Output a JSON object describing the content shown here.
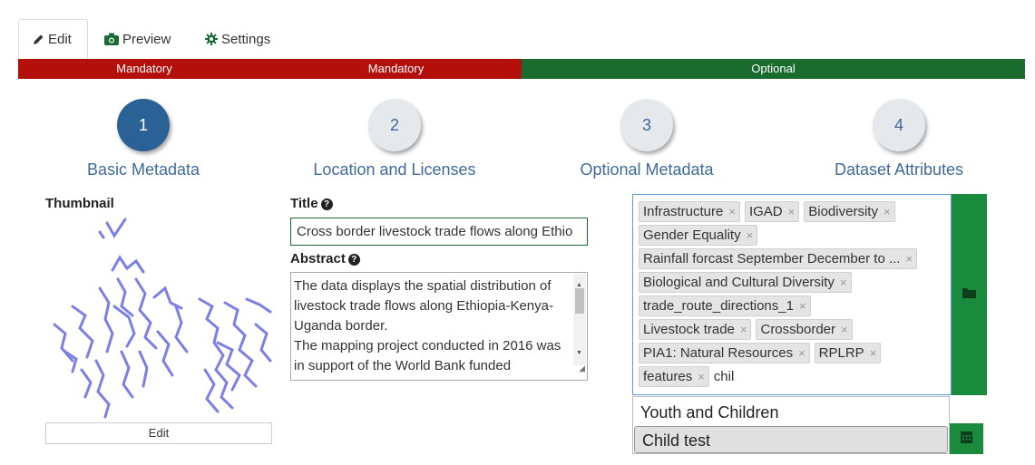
{
  "tabs": [
    {
      "label": "Edit",
      "icon": "pencil-icon"
    },
    {
      "label": "Preview",
      "icon": "camera-icon"
    },
    {
      "label": "Settings",
      "icon": "gear-icon"
    }
  ],
  "progress": [
    {
      "label": "Mandatory",
      "color": "#b30f0b"
    },
    {
      "label": "Mandatory",
      "color": "#b30f0b"
    },
    {
      "label": "Optional",
      "color": "#1a6b2e"
    }
  ],
  "steps": [
    {
      "number": "1",
      "label": "Basic Metadata",
      "active": true
    },
    {
      "number": "2",
      "label": "Location and Licenses"
    },
    {
      "number": "3",
      "label": "Optional Metadata"
    },
    {
      "number": "4",
      "label": "Dataset Attributes"
    }
  ],
  "thumbnail": {
    "label": "Thumbnail",
    "edit_label": "Edit"
  },
  "title": {
    "label": "Title",
    "value": "Cross border livestock trade flows along Ethio"
  },
  "abstract": {
    "label": "Abstract",
    "lines": [
      "The data displays the spatial distribution of livestock trade flows along Ethiopia-Kenya-Uganda border.",
      "The mapping project conducted in 2016 was in support of the World Bank funded"
    ]
  },
  "tags": {
    "rows": [
      [
        "Infrastructure",
        "IGAD",
        "Biodiversity"
      ],
      [
        "Gender Equality"
      ],
      [
        "Rainfall forcast September December to ..."
      ],
      [
        "Biological and Cultural Diversity"
      ],
      [
        "trade_route_directions_1"
      ],
      [
        "Livestock trade",
        "Crossborder"
      ],
      [
        "PIA1: Natural Resources",
        "RPLRP"
      ],
      [
        "features"
      ]
    ],
    "typed": "chil",
    "remove_glyph": "×"
  },
  "suggestions": [
    "Youth and Children",
    "Child test"
  ],
  "colors": {
    "accent_green": "#1a8a3c",
    "step_blue": "#2a6296",
    "mandatory_red": "#b30f0b"
  }
}
